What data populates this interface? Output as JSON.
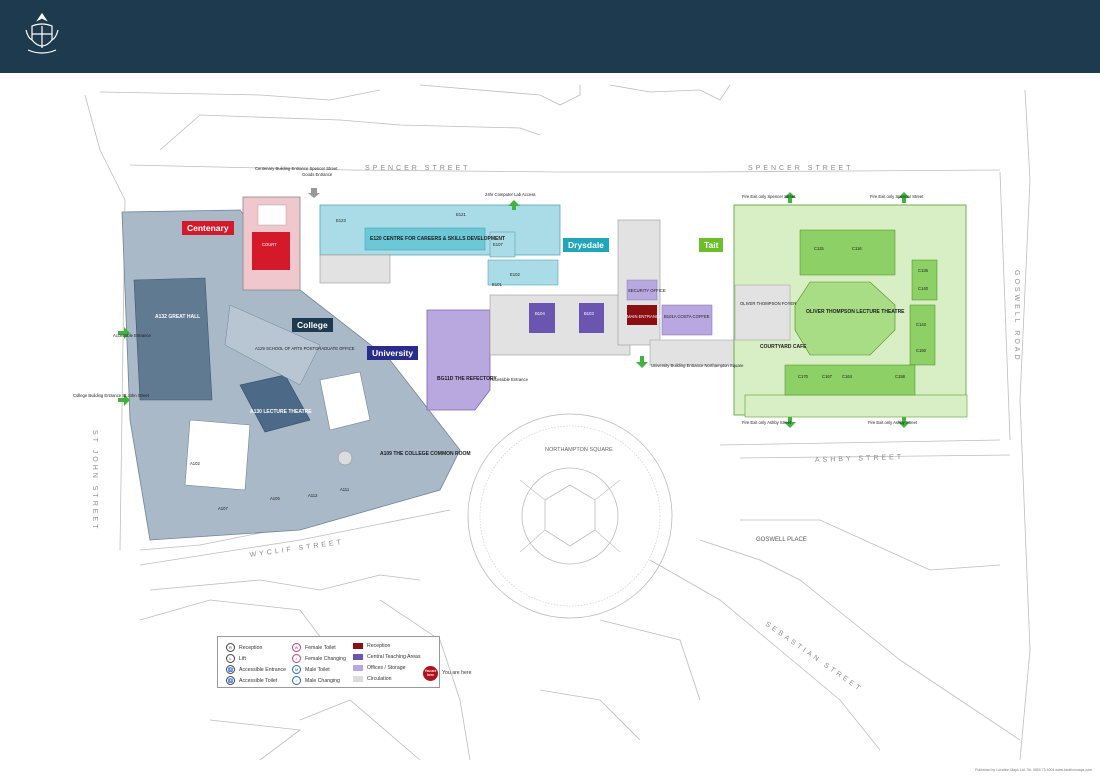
{
  "header": {
    "logo_name": "university-crest"
  },
  "buildings": {
    "centenary": {
      "label": "Centenary",
      "color": "#d4192b"
    },
    "college": {
      "label": "College",
      "color": "#1e3a4f"
    },
    "drysdale": {
      "label": "Drysdale",
      "color": "#1fa6b8"
    },
    "university": {
      "label": "University",
      "color": "#2a2c8c"
    },
    "tait": {
      "label": "Tait",
      "color": "#6cbf2a"
    }
  },
  "streets": {
    "spencer_left": "SPENCER STREET",
    "spencer_right": "SPENCER STREET",
    "goswell_road": "GOSWELL ROAD",
    "ashby": "ASHBY STREET",
    "st_john": "ST JOHN STREET",
    "wyclif": "WYCLIF STREET",
    "goswell_place": "GOSWELL PLACE",
    "sebastian": "SEBASTIAN STREET",
    "northampton": "NORTHAMPTON SQUARE"
  },
  "annotations": {
    "centenary_entrance": "Centenary Building Entrance Spencer Street",
    "goods_entrance": "Goods Entrance",
    "computer_lab": "24hr Computer Lab Access",
    "accessible_entrance_college": "Accessible Entrance",
    "college_entrance": "College Building Entrance St John Street",
    "accessible_entrance_univ": "Accessible Entrance",
    "university_entrance": "University Building Entrance Northampton Square",
    "fire_exit_spencer_1": "Fire Exit only Spencer Street",
    "fire_exit_spencer_2": "Fire Exit only Spencer Street",
    "fire_exit_ashby_1": "Fire Exit only Ashby Street",
    "fire_exit_ashby_2": "Fire Exit only Ashby Street"
  },
  "rooms": {
    "great_hall": "A132 GREAT HALL",
    "lecture_theatre_a": "A130 LECTURE THEATRE",
    "common_room": "A109 THE COLLEGE COMMON ROOM",
    "refectory": "BG11D THE REFECTORY",
    "careers": "E120 CENTRE FOR CAREERS & SKILLS DEVELOPMENT",
    "oliver_thompson": "OLIVER THOMPSON LECTURE THEATRE",
    "courtyard_cafe": "COURTYARD CAFE",
    "main_entrance": "MAIN ENTRANCE",
    "security": "SECURITY OFFICE",
    "foyer": "OLIVER THOMPSON FOYER",
    "arts_office": "A129 SCHOOL OF ARTS POSTGRADUATE OFFICE",
    "costa": "B101A COSTA COFFEE",
    "court": "COURT",
    "c115": "C115",
    "c116": "C116",
    "c135": "C135",
    "c140": "C140",
    "c143": "C143",
    "c150": "C150",
    "c170": "C170",
    "c167": "C167",
    "c164": "C164",
    "c158": "C158",
    "b104": "B104",
    "b103": "B103",
    "e123": "E123",
    "e121": "E121",
    "a102": "A102",
    "a112": "A112",
    "a111": "A111",
    "a105": "A105",
    "a107": "A107",
    "e107": "E107",
    "e101": "E101",
    "e102": "E102"
  },
  "legend": {
    "reception": "Reception",
    "lift": "Lift",
    "accessible_entrance": "Accessible Entrance",
    "accessible_toilet": "Accessible Toilet",
    "female_toilet": "Female Toilet",
    "female_changing": "Female Changing",
    "male_toilet": "Male Toilet",
    "male_changing": "Male Changing",
    "reception_area": "Reception",
    "central_teaching": "Central Teaching Areas",
    "offices": "Offices / Storage",
    "circulation": "Circulation",
    "you_are_here": "You are here",
    "you_are_here_badge": "You are here",
    "colors": {
      "reception": "#8b0e12",
      "teaching": "#6a55b0",
      "offices": "#b9a8e0",
      "circulation": "#dcdcdc"
    }
  },
  "credit": "Published by Location Maps Ltd. Tel. 0800 73 4004 www.locationmaps.com"
}
